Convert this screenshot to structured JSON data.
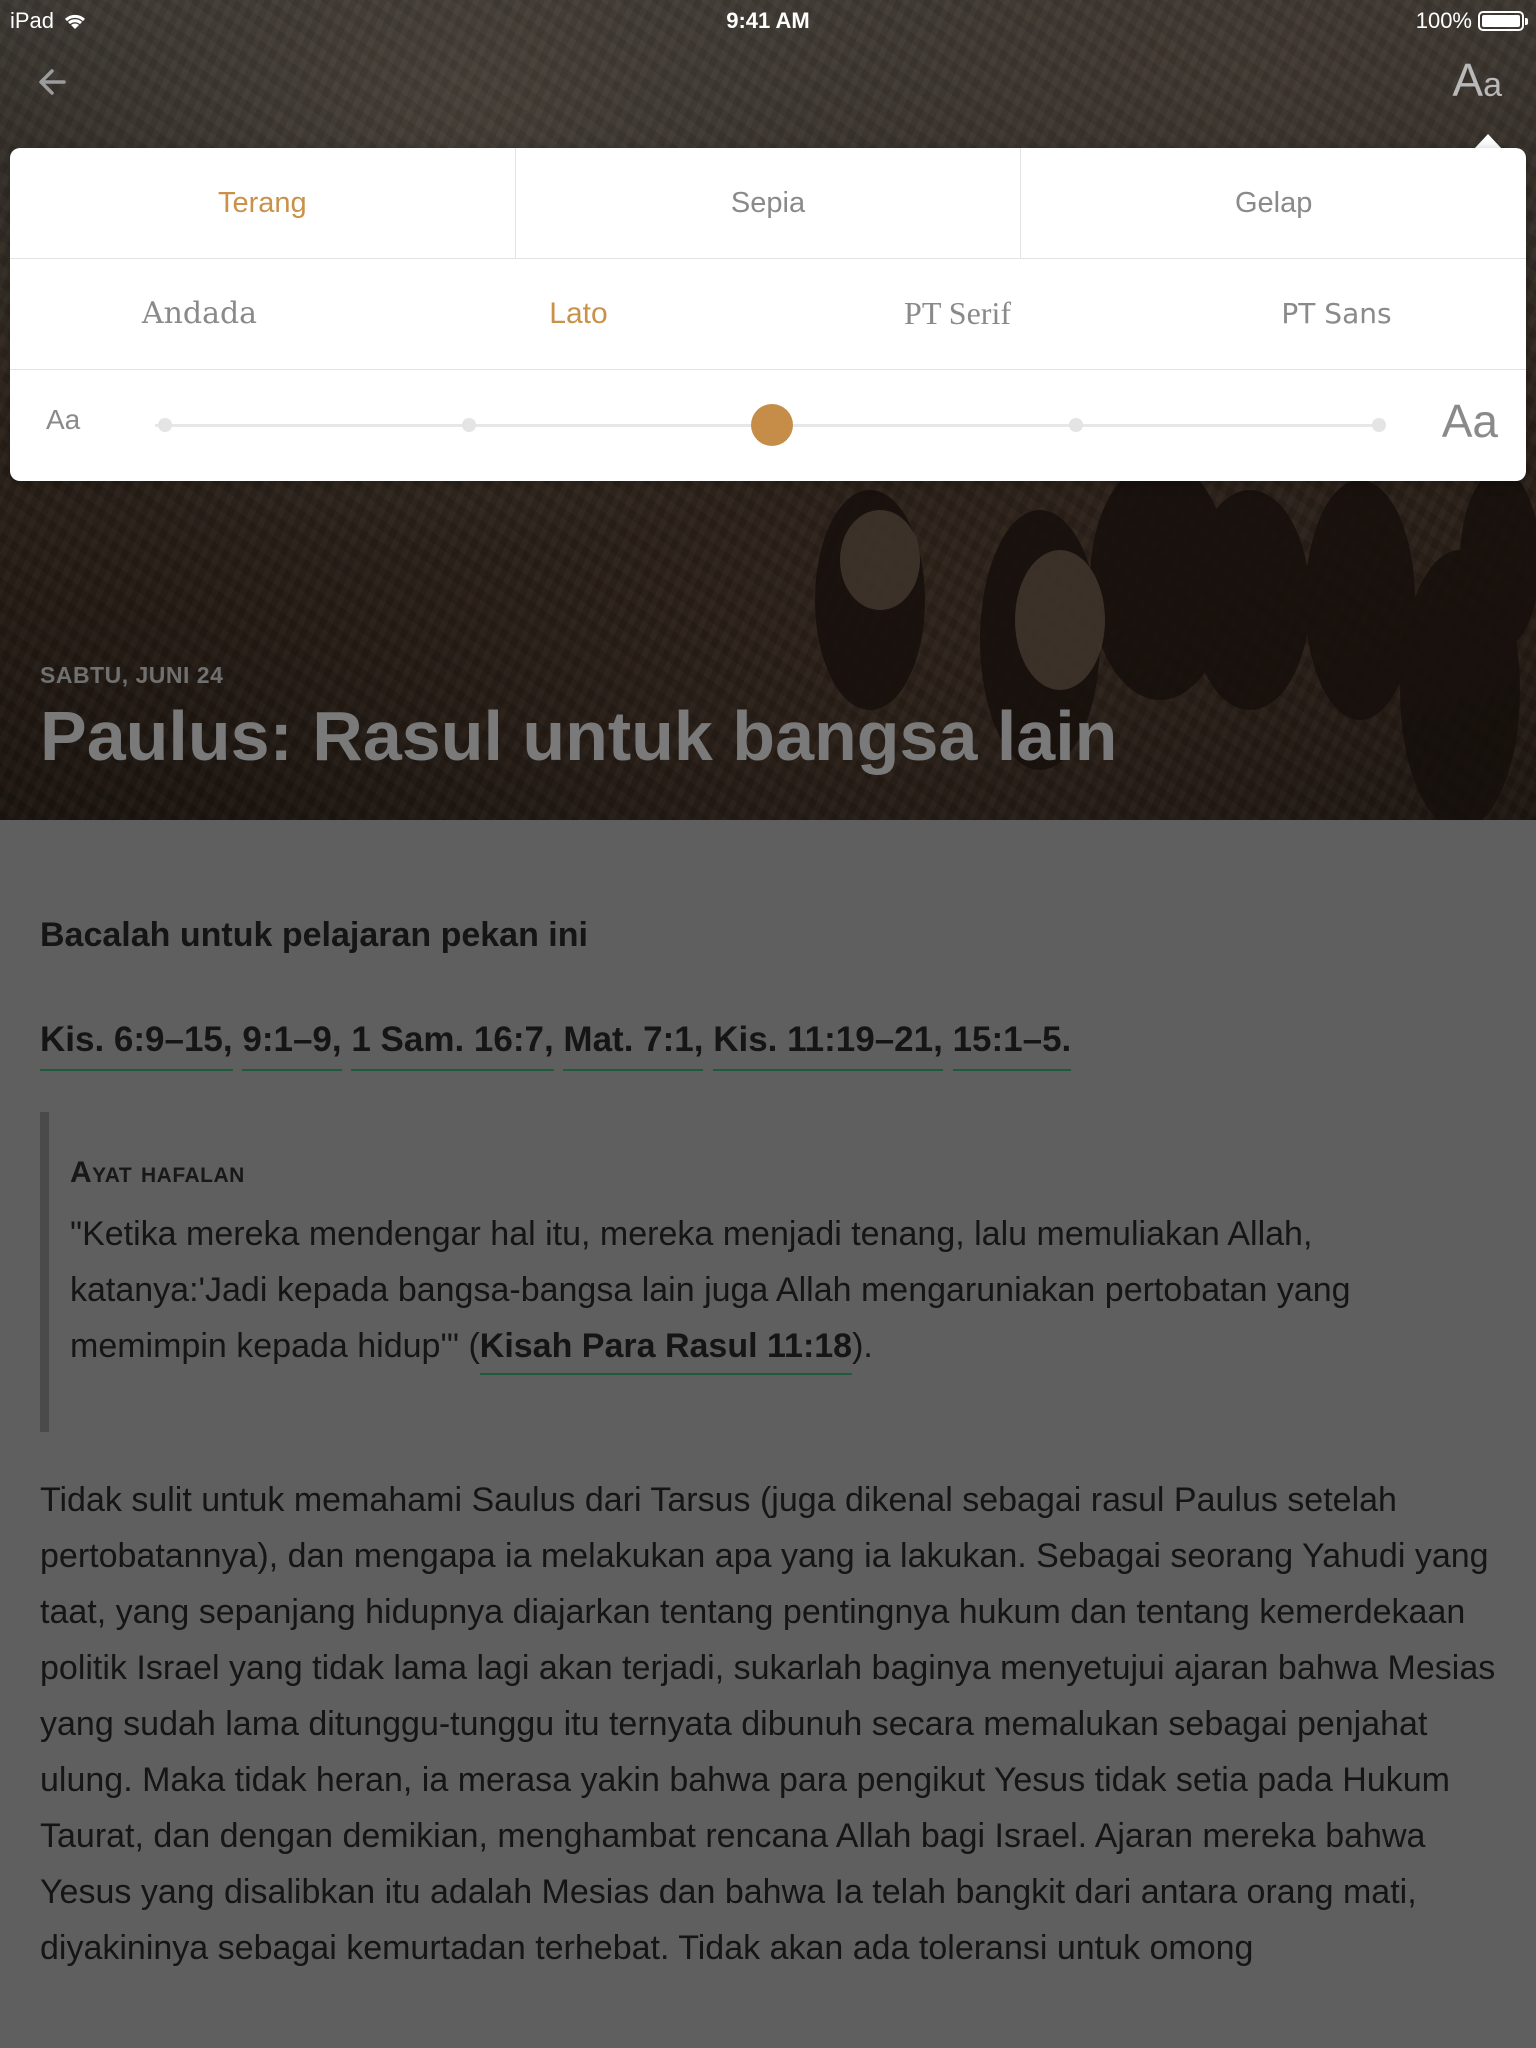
{
  "status_bar": {
    "device": "iPad",
    "time": "9:41 AM",
    "battery": "100%"
  },
  "nav": {
    "back_icon": "arrow-left-icon",
    "text_settings_label_big": "A",
    "text_settings_label_small": "a"
  },
  "settings": {
    "themes": [
      {
        "label": "Terang",
        "active": true
      },
      {
        "label": "Sepia",
        "active": false
      },
      {
        "label": "Gelap",
        "active": false
      }
    ],
    "fonts": [
      {
        "label": "Andada",
        "active": false
      },
      {
        "label": "Lato",
        "active": true
      },
      {
        "label": "PT Serif",
        "active": false
      },
      {
        "label": "PT Sans",
        "active": false
      }
    ],
    "size": {
      "small_label": "Aa",
      "large_label": "Aa",
      "steps": 5,
      "selected_step": 3
    },
    "accent_color": "#c9914a"
  },
  "header": {
    "date": "SABTU, JUNI 24",
    "title": "Paulus: Rasul untuk bangsa lain"
  },
  "content": {
    "read_heading": "Bacalah untuk pelajaran pekan ini",
    "references": [
      "Kis. 6:9–15,",
      "9:1–9,",
      "1 Sam. 16:7,",
      "Mat. 7:1,",
      "Kis. 11:19–21,",
      "15:1–5."
    ],
    "memory_verse": {
      "title": "Ayat hafalan",
      "text_before": "\"Ketika mereka mendengar hal itu, mereka menjadi tenang, lalu memuliakan Allah, katanya:'Jadi kepada bangsa-bangsa lain juga Allah mengaruniakan pertobatan yang memimpin kepada hidup'\" (",
      "reference": "Kisah Para Rasul 11:18",
      "text_after": ")."
    },
    "body": "Tidak sulit untuk memahami Saulus dari Tarsus (juga dikenal sebagai rasul Paulus setelah pertobatannya), dan mengapa ia melakukan apa yang ia lakukan. Sebagai seorang Yahudi yang taat, yang sepanjang hidupnya diajarkan tentang pentingnya hukum dan tentang kemerdekaan politik Israel yang tidak lama lagi akan terjadi, sukarlah baginya menyetujui ajaran bahwa Mesias yang sudah lama ditunggu-tunggu itu ternyata dibunuh secara memalukan sebagai penjahat ulung. Maka tidak heran, ia merasa yakin bahwa para pengikut Yesus tidak setia pada Hukum Taurat, dan dengan demikian, menghambat rencana Allah bagi Israel. Ajaran mereka bahwa Yesus yang disalibkan itu adalah Mesias dan bahwa Ia telah bangkit dari antara orang mati, diyakininya sebagai kemurtadan terhebat. Tidak akan ada toleransi untuk omong"
  }
}
